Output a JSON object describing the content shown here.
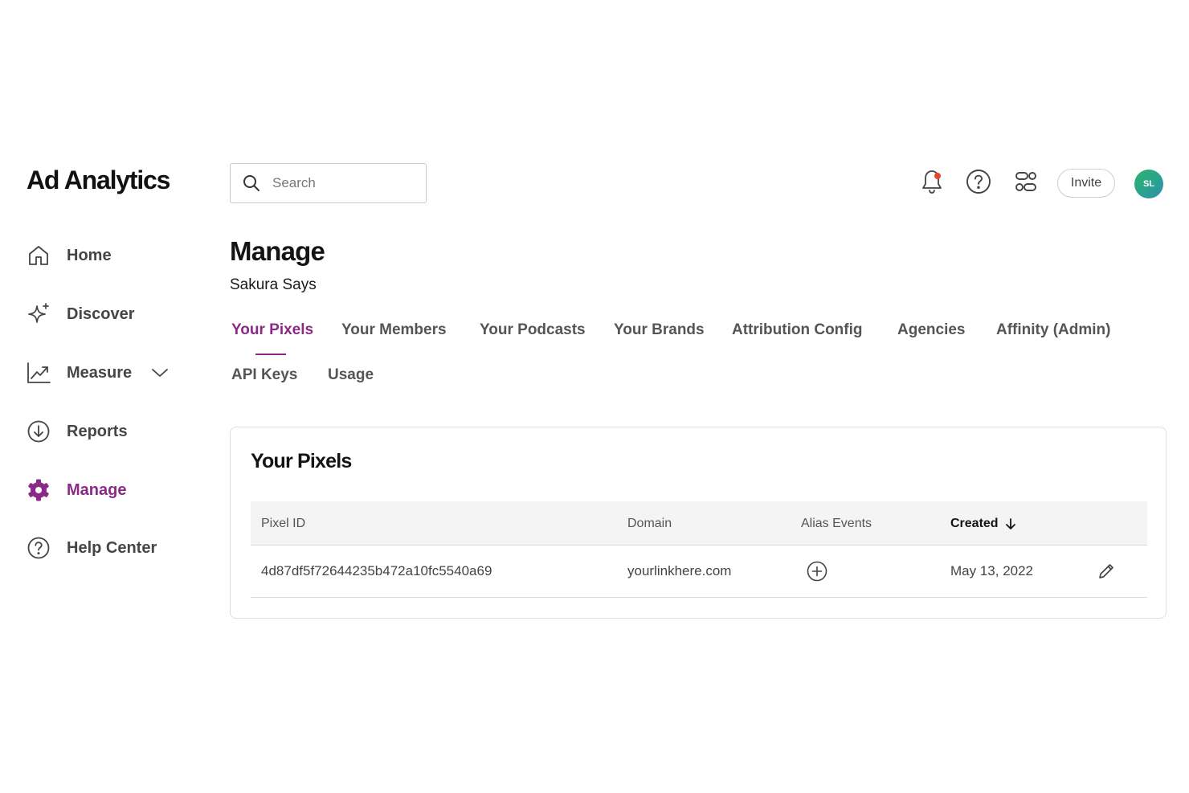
{
  "app": {
    "logo": "Ad Analytics"
  },
  "search": {
    "placeholder": "Search"
  },
  "header_actions": {
    "invite_label": "Invite",
    "avatar_initials": "SL",
    "notification_dot_color": "#e8452c"
  },
  "sidebar": {
    "items": [
      {
        "label": "Home",
        "icon": "home-icon"
      },
      {
        "label": "Discover",
        "icon": "sparkle-icon"
      },
      {
        "label": "Measure",
        "icon": "chart-line-icon",
        "expandable": true
      },
      {
        "label": "Reports",
        "icon": "download-circle-icon"
      },
      {
        "label": "Manage",
        "icon": "gear-icon",
        "active": true
      },
      {
        "label": "Help Center",
        "icon": "help-circle-icon"
      }
    ]
  },
  "page": {
    "title": "Manage",
    "subtitle": "Sakura Says"
  },
  "tabs": [
    {
      "label": "Your Pixels",
      "active": true
    },
    {
      "label": "Your Members"
    },
    {
      "label": "Your Podcasts"
    },
    {
      "label": "Your Brands"
    },
    {
      "label": "Attribution Config"
    },
    {
      "label": "Agencies"
    },
    {
      "label": "Affinity (Admin)"
    },
    {
      "label": "API Keys"
    },
    {
      "label": "Usage"
    }
  ],
  "pixels_card": {
    "title": "Your Pixels",
    "columns": [
      "Pixel ID",
      "Domain",
      "Alias Events",
      "Created"
    ],
    "sorted_column": "Created",
    "sort_direction": "descending",
    "rows": [
      {
        "pixel_id": "4d87df5f72644235b472a10fc5540a69",
        "domain": "yourlinkhere.com",
        "created": "May 13, 2022"
      }
    ]
  },
  "colors": {
    "accent": "#8a2a86",
    "text_primary": "#141414",
    "text_secondary": "#555555",
    "table_header_bg": "#f4f4f4",
    "border": "#dedede"
  }
}
